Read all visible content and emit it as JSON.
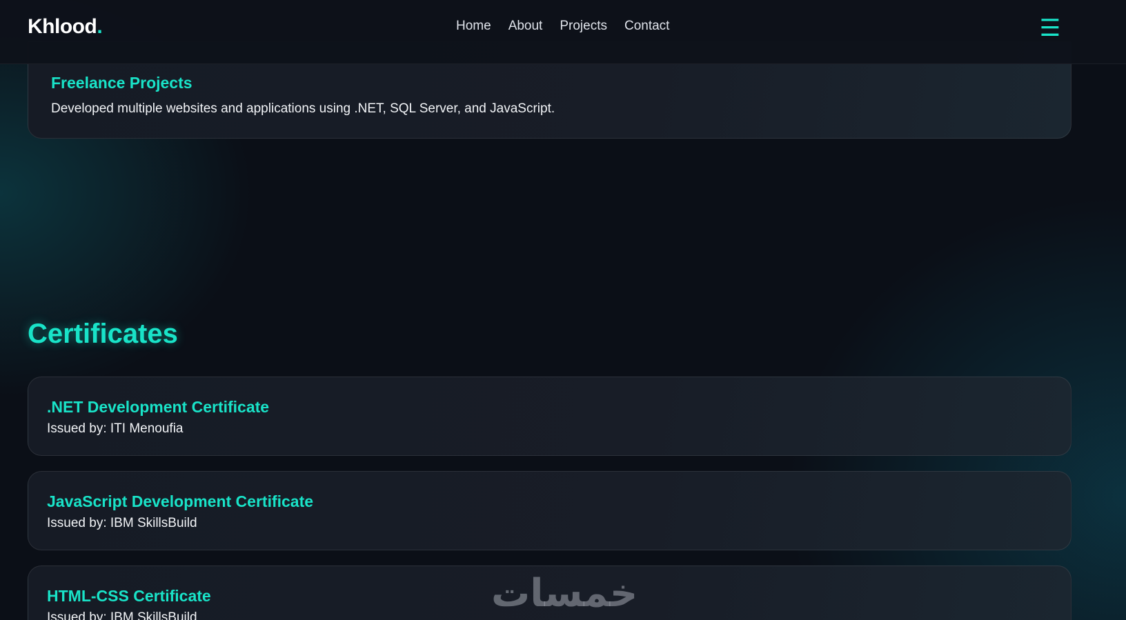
{
  "navbar": {
    "logo_text": "Khlood",
    "logo_dot": ".",
    "links": [
      "Home",
      "About",
      "Projects",
      "Contact"
    ],
    "menu_icon": "hamburger-menu-icon",
    "menu_glyph": "☰"
  },
  "experience": {
    "items": [
      {
        "title": "Freelance Projects",
        "description": "Developed multiple websites and applications using .NET, SQL Server, and JavaScript."
      }
    ]
  },
  "certificates": {
    "title": "Certificates",
    "items": [
      {
        "title": ".NET Development Certificate",
        "issuer": "Issued by: ITI Menoufia"
      },
      {
        "title": "JavaScript Development Certificate",
        "issuer": "Issued by: IBM SkillsBuild"
      },
      {
        "title": "HTML-CSS Certificate",
        "issuer": "Issued by: IBM SkillsBuild"
      }
    ]
  },
  "watermark": {
    "text": "خمسات"
  },
  "colors": {
    "accent": "#19e3c8",
    "background": "#0b0f17",
    "card": "#161b25",
    "text": "#f2f4f7"
  }
}
